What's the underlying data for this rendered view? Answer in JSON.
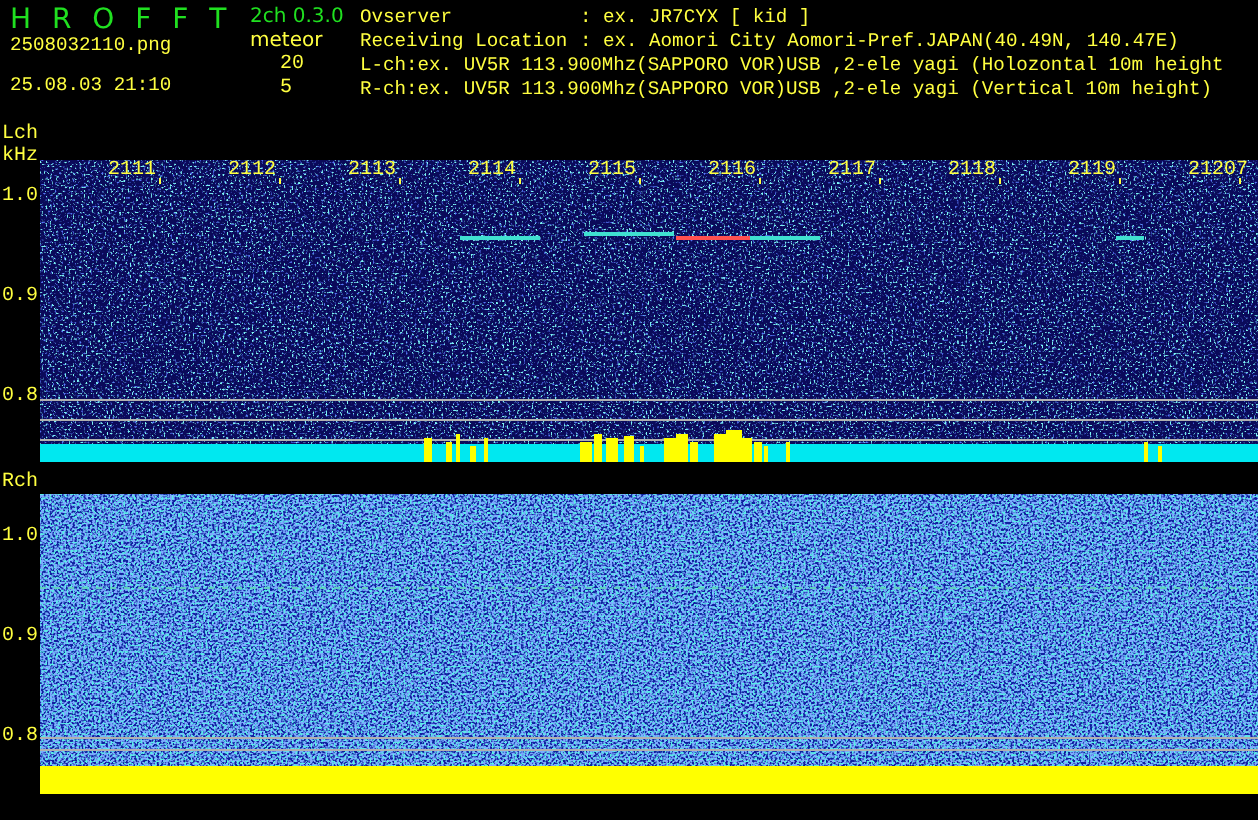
{
  "app": {
    "title": "H R O F F T",
    "version": "2ch 0.3.0",
    "filename": "2508032110.png",
    "datetime": "25.08.03 21:10",
    "mode": "meteor",
    "counts": [
      "20",
      "5"
    ]
  },
  "info": [
    {
      "kind": "field",
      "label": "Ovserver",
      "value": ": ex. JR7CYX [ kid ]"
    },
    {
      "kind": "field",
      "label": "Receiving Location",
      "value": ": ex. Aomori City Aomori-Pref.JAPAN(40.49N, 140.47E)"
    },
    {
      "kind": "line",
      "text": "L-ch:ex. UV5R 113.900Mhz(SAPPORO VOR)USB ,2-ele yagi (Holozontal 10m height"
    },
    {
      "kind": "line",
      "text": "R-ch:ex. UV5R 113.900Mhz(SAPPORO VOR)USB ,2-ele yagi (Vertical 10m height)"
    }
  ],
  "panels": [
    {
      "kind": "left",
      "name": "Lch",
      "unit": "kHz",
      "yticks": [
        "1.0",
        "0.9",
        "0.8"
      ],
      "time_labels": [
        "2111",
        "2112",
        "2113",
        "2114",
        "2115",
        "2116",
        "2117",
        "2118",
        "2119",
        "21207"
      ]
    },
    {
      "kind": "right",
      "name": "Rch",
      "yticks": [
        "1.0",
        "0.9",
        "0.8"
      ]
    }
  ]
}
